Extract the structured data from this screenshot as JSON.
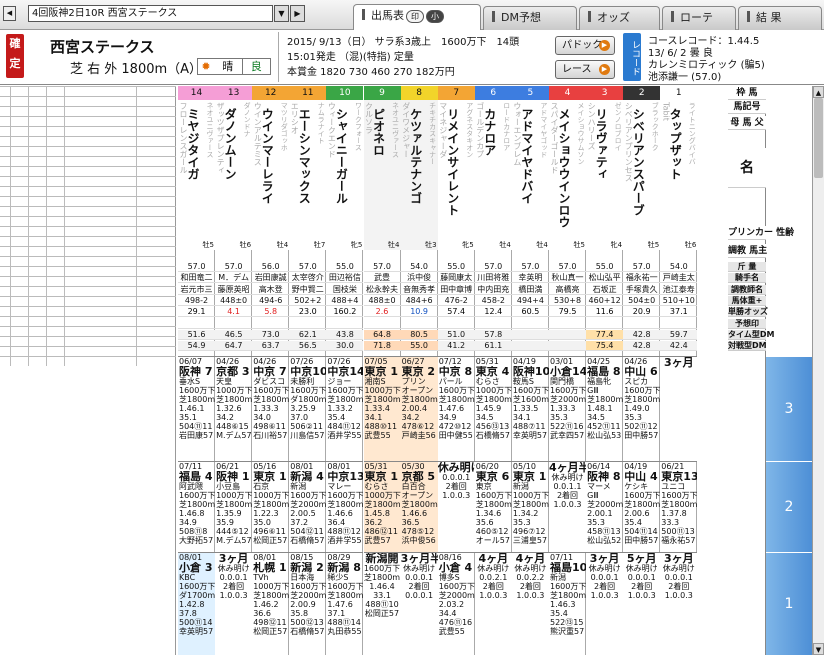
{
  "app": {
    "race_select": "4回阪神2日10R 西宮ステークス",
    "tabs": [
      {
        "label": "出馬表",
        "pills": [
          "印",
          "小"
        ],
        "active": true
      },
      {
        "label": "DM予想",
        "pills": [],
        "active": false
      },
      {
        "label": "オッズ",
        "pills": [],
        "active": false
      },
      {
        "label": "ローテ",
        "pills": [],
        "active": false
      },
      {
        "label": "結 果",
        "pills": [],
        "active": false
      }
    ]
  },
  "header": {
    "status": "確定",
    "race_name": "西宮ステークス",
    "course": "芝 右 外 1800m（A）",
    "weather": "晴",
    "ground": "良",
    "line1": "2015/ 9/13（日） サラ系3歳上　1600万下　14頭",
    "line2": "15:01発走 （混)(特指) 定量",
    "line3": "本賞金 1820 730 460 270 182万円",
    "paddock_label": "パドック",
    "race_label": "レース",
    "record_label": "レコード",
    "course_record": "コースレコード：1.44.5",
    "record_date": "13/ 6/ 2 曇 良",
    "record_horse": "カレンミロティック (騙5)",
    "record_jockey": "池添謙一 (57.0)"
  },
  "colors": {
    "w1": "#ffffff",
    "w2": "#333333",
    "w3": "#e84040",
    "w4": "#3d7de0",
    "w5": "#f2d42a",
    "w6": "#3aa646",
    "w7": "#f3a534",
    "w8": "#f59ed6",
    "tier": "#5a9ad9",
    "highlight": "#ffe0c0",
    "blueish": "#cfe5ff"
  },
  "right_labels": {
    "waku": "枠 馬",
    "umaban": "馬記号",
    "name_block": "母 馬 父",
    "name": "名",
    "breeder": "プリンカー 性齢",
    "owner": "調教 馬主",
    "rows": [
      "斤 量",
      "騎手名",
      "調教師名",
      "馬体重+",
      "単勝オッズ",
      "予想印",
      "タイム型DM",
      "対戦型DM"
    ]
  },
  "tiers": [
    "3",
    "2",
    "1"
  ],
  "horses": [
    {
      "waku": "14",
      "waku_c": "#f59ed6",
      "sire": "フローレンスガール",
      "name": "ミヤジタイガ",
      "dam": "ネオユニヴァース",
      "sex": "牡5",
      "weight": "57.0",
      "jockey": "和田竜二",
      "trainer": "岩元市三",
      "bw": "498-2",
      "odds": "29.1",
      "odds_c": "#000000",
      "dm1": "51.6",
      "dm2": "54.9",
      "p3": [
        "06/07",
        "阪神 7",
        "垂水S",
        "1600万下",
        "芝1800m",
        "1.46.1",
        "35.1",
        "504⑪11",
        "岩田康57"
      ],
      "p3r": "7",
      "p2": [
        "07/11",
        "福島 4",
        "阿武隈",
        "1600万下",
        "芝1800m",
        "1.46.8",
        "34.9",
        "508⑪8",
        "大野拓57"
      ],
      "p2r": "4",
      "p1": [
        "08/01",
        "小倉 3",
        "KBC",
        "1600万下",
        "ダ1700m",
        "1.42.8",
        "37.8",
        "500⑪14",
        "幸英明57"
      ],
      "p1r": "3"
    },
    {
      "waku": "13",
      "waku_c": "#f59ed6",
      "sire": "ザッツザプレンティ",
      "name": "ダノンムーン",
      "dam": "ダノンドナ",
      "sex": "牡6",
      "weight": "57.0",
      "jockey": "M．デム",
      "trainer": "藤原英昭",
      "bw": "448±0",
      "odds": "4.1",
      "odds_c": "#e02020",
      "dm1": "46.5",
      "dm2": "64.7",
      "p3": [
        "04/26",
        "京都 3",
        "天皇",
        "1000万下",
        "芝1800m",
        "1.32.6",
        "34.2",
        "448⑥15",
        "M.デム57"
      ],
      "p3r": "3",
      "p2": [
        "06/21",
        "阪神 1",
        "小豆島",
        "1000万下",
        "芝1800m",
        "1.35.9",
        "35.9",
        "444⑤12",
        "M.デム57"
      ],
      "p2r": "1",
      "p1": [
        "",
        "3ヶ月",
        "",
        "休み明け",
        "0.0.0.1",
        "2着回",
        "",
        "1.0.0.3",
        ""
      ],
      "p1r": ""
    },
    {
      "waku": "12",
      "waku_c": "#f3a534",
      "sire": "ウインアルテミス",
      "name": "ウインマーレライ",
      "dam": "マツリダゴッホ",
      "sex": "牡4",
      "weight": "56.0",
      "jockey": "岩田康誠",
      "trainer": "高木登",
      "bw": "494-6",
      "odds": "5.8",
      "odds_c": "#e02020",
      "dm1": "73.0",
      "dm2": "63.7",
      "p3": [
        "04/26",
        "中京 7",
        "ダビスコ",
        "1600万下",
        "芝1800m",
        "1.33.3",
        "34.0",
        "498⑥11",
        "石川裕57"
      ],
      "p3r": "7",
      "p2": [
        "05/16",
        "東京 1",
        "石京",
        "1000万下",
        "芝1800m",
        "1.22.3",
        "35.0",
        "496⑥11",
        "松岡正57"
      ],
      "p2r": "1",
      "p1": [
        "08/01",
        "札幌 1",
        "TVh",
        "1000万下",
        "芝1800m",
        "1.46.2",
        "36.6",
        "498⑫11",
        "松岡正57"
      ],
      "p1r": "1"
    },
    {
      "waku": "11",
      "waku_c": "#f3a534",
      "sire": "エリシオ",
      "name": "エーシンマックス",
      "dam": "ナムラナイト",
      "sex": "牡7",
      "weight": "57.0",
      "jockey": "太宰啓介",
      "trainer": "野中賢二",
      "bw": "502+2",
      "odds": "23.0",
      "odds_c": "#000000",
      "dm1": "62.1",
      "dm2": "56.5",
      "p3": [
        "07/26",
        "中京10",
        "未勝利",
        "1600万下",
        "ダ1800m",
        "3.25.9",
        "37.0",
        "506②11",
        "川島信57"
      ],
      "p3r": "10",
      "p2": [
        "08/01",
        "新潟 4",
        "新潟",
        "1600万下",
        "芝2000m",
        "2.00.5",
        "37.2",
        "504⑫11",
        "石橋脩57"
      ],
      "p2r": "4",
      "p1": [
        "08/15",
        "新潟 2",
        "日本海",
        "1600万下",
        "芝2000m",
        "2.00.9",
        "35.8",
        "500⑫13",
        "石橋脩57"
      ],
      "p1r": "2"
    },
    {
      "waku": "10",
      "waku_c": "#3aa646",
      "sire": "ウィークエンド",
      "name": "シャイニーガール",
      "dam": "ワークフォース",
      "sex": "牝5",
      "weight": "55.0",
      "jockey": "田辺裕信",
      "trainer": "国枝栄",
      "bw": "488+4",
      "odds": "160.2",
      "odds_c": "#000000",
      "dm1": "43.8",
      "dm2": "30.0",
      "p3": [
        "07/26",
        "中京14",
        "ジョー",
        "1600万下",
        "芝1800m",
        "1.33.2",
        "35.4",
        "484⑪12",
        "酒井学55"
      ],
      "p3r": "14",
      "p2": [
        "08/01",
        "中京13",
        "マレー",
        "1600万下",
        "芝1800m",
        "1.46.6",
        "36.4",
        "488⑪12",
        "酒井学55"
      ],
      "p2r": "13",
      "p1": [
        "08/29",
        "新潟 8",
        "稀少S",
        "1600万下",
        "芝1800m",
        "1.47.6",
        "37.1",
        "488⑪14",
        "丸田恭55"
      ],
      "p1r": "8"
    },
    {
      "waku": "9",
      "waku_c": "#3aa646",
      "sire": "クルソラ",
      "name": "ピオネロ",
      "dam": "ネオユニヴァース",
      "sex": "牡4",
      "weight": "57.0",
      "jockey": "武豊",
      "trainer": "松永幹夫",
      "bw": "488±0",
      "odds": "2.6",
      "odds_c": "#e02020",
      "dm1": "64.8",
      "dm2": "71.8",
      "hl": true,
      "p3": [
        "07/05",
        "東京 1",
        "湘南S",
        "1000万下",
        "芝1800m",
        "1.33.4",
        "34.1",
        "488⑩11",
        "武豊55"
      ],
      "p3r": "1",
      "p2": [
        "05/31",
        "東京 1",
        "むらさ",
        "1000万下",
        "芝1800m",
        "1.45.8",
        "36.2",
        "486⑫11",
        "武豊57"
      ],
      "p2r": "1",
      "p1": [
        "",
        "新潟開",
        "",
        "1600万下",
        "芝1800m",
        "1.46.4",
        "33.1",
        "488⑪10",
        "松岡正57"
      ],
      "p1r": ""
    },
    {
      "waku": "8",
      "waku_c": "#f2d42a",
      "sire": "ダイワメジャー",
      "name": "ケツァルテナンゴ",
      "dam": "チキチカスキャナー",
      "sex": "牡3",
      "weight": "54.0",
      "jockey": "浜中俊",
      "trainer": "音無秀孝",
      "bw": "484+6",
      "odds": "10.9",
      "odds_c": "#1050c0",
      "dm1": "80.5",
      "dm2": "55.0",
      "hl": true,
      "p3": [
        "06/27",
        "東京 2",
        "プリン",
        "オープン",
        "芝1800m",
        "2.00.4",
        "34.2",
        "478⑥12",
        "戸崎圭56"
      ],
      "p3r": "2",
      "p2": [
        "05/30",
        "京都 5",
        "白百合",
        "オープン",
        "芝1800m",
        "1.46.6",
        "36.5",
        "478⑤12",
        "浜中俊56"
      ],
      "p2r": "5",
      "p1": [
        "",
        "3ヶ月半",
        "",
        "休み明け",
        "0.0.0.1",
        "2着回",
        "",
        "0.0.0.1",
        ""
      ],
      "p1r": ""
    },
    {
      "waku": "7",
      "waku_c": "#f3a534",
      "sire": "マイネジャーダ",
      "name": "リメインサイレント",
      "dam": "アグネスタキオン",
      "sex": "牝5",
      "weight": "55.0",
      "jockey": "藤岡康太",
      "trainer": "田中章博",
      "bw": "476-2",
      "odds": "57.4",
      "odds_c": "#000000",
      "dm1": "51.0",
      "dm2": "41.2",
      "p3": [
        "07/12",
        "中京 8",
        "パール",
        "1600万下",
        "芝1800m",
        "1.47.6",
        "34.9",
        "472⑩12",
        "田中健55"
      ],
      "p3r": "8",
      "p2": [
        "",
        "休み明け",
        "",
        "0.0.0.1",
        "2着回",
        "",
        "",
        "1.0.0.3",
        ""
      ],
      "p2r": "",
      "p1": [
        "08/16",
        "小倉 4",
        "博多S",
        "1600万下",
        "芝2000m",
        "2.03.2",
        "34.4",
        "476⑪16",
        "武豊55"
      ],
      "p1r": "4"
    },
    {
      "waku": "6",
      "waku_c": "#3d7de0",
      "sire": "ゴールデンカプ",
      "name": "カナロア",
      "dam": "ロードカナロア",
      "sex": "牡4",
      "weight": "57.0",
      "jockey": "川田将雅",
      "trainer": "中内田充",
      "bw": "458-2",
      "odds": "12.4",
      "odds_c": "#000000",
      "dm1": "57.8",
      "dm2": "61.1",
      "p3": [
        "05/31",
        "東京 4",
        "むらさ",
        "1000万下",
        "芝1800m",
        "1.45.9",
        "34.5",
        "456⑬13",
        "石橋脩57"
      ],
      "p3r": "4",
      "p2": [
        "06/20",
        "東京 6",
        "東京",
        "1600万下",
        "芝1800m",
        "1.34.6",
        "35.6",
        "460⑤12",
        "オール57"
      ],
      "p2r": "6",
      "p1": [
        "",
        "4ヶ月",
        "",
        "休み明け",
        "0.0.2.1",
        "2着回",
        "",
        "1.0.0.3",
        ""
      ],
      "p1r": ""
    },
    {
      "waku": "5",
      "waku_c": "#3d7de0",
      "sire": "ウォーエンブレム",
      "name": "アドマイヤドバイ",
      "dam": "アドマイヤゴッド",
      "sex": "牡4",
      "weight": "57.0",
      "jockey": "幸英明",
      "trainer": "橋田満",
      "bw": "494+4",
      "odds": "60.5",
      "odds_c": "#000000",
      "dm1": "",
      "dm2": "",
      "p3": [
        "04/19",
        "阪神10",
        "鞍馬S",
        "1600万下",
        "芝1600m",
        "1.33.5",
        "34.1",
        "488⑦11",
        "幸英明57"
      ],
      "p3r": "10",
      "p2": [
        "05/10",
        "東京 1",
        "新潟",
        "1000万下",
        "芝1800m",
        "1.34.2",
        "35.3",
        "496⑦12",
        "三浦皇57"
      ],
      "p2r": "1",
      "p1": [
        "",
        "4ヶ月",
        "",
        "休み明け",
        "0.0.2.2",
        "2着回",
        "",
        "1.0.0.3",
        ""
      ],
      "p1r": ""
    },
    {
      "waku": "4",
      "waku_c": "#e84040",
      "sire": "スパイダーゴールド",
      "name": "メイショウウインロウ",
      "dam": "メイショウサムソン",
      "sex": "牡5",
      "weight": "57.0",
      "jockey": "秋山真一",
      "trainer": "高橋亮",
      "bw": "530+8",
      "odds": "79.5",
      "odds_c": "#000000",
      "dm1": "",
      "dm2": "",
      "p3": [
        "03/01",
        "小倉14",
        "関門橋",
        "1600万下",
        "芝2000m",
        "1.33.3",
        "35.3",
        "522⑪16",
        "武幸四57"
      ],
      "p3r": "14",
      "p2": [
        "",
        "4ヶ月半",
        "",
        "休み明け",
        "0.0.1.1",
        "2着回",
        "",
        "1.0.0.3",
        ""
      ],
      "p2r": "",
      "p1": [
        "07/11",
        "福島10",
        "新潟",
        "1600万下",
        "芝1800m",
        "1.46.3",
        "35.4",
        "522⑬15",
        "熊沢重57"
      ],
      "p1r": "10"
    },
    {
      "waku": "3",
      "waku_c": "#e84040",
      "sire": "シンハリーズ",
      "name": "リラヴァティ",
      "dam": "ゼンノロブロイ",
      "sex": "牝4",
      "weight": "55.0",
      "jockey": "松山弘平",
      "trainer": "石坂正",
      "bw": "460+12",
      "odds": "11.6",
      "odds_c": "#000000",
      "dm1": "77.4",
      "dm2": "75.4",
      "hl2": true,
      "p3": [
        "04/25",
        "福島 8",
        "福島牝",
        "GⅢ",
        "芝1800m",
        "1.48.1",
        "34.5",
        "452⑪11",
        "松山弘53"
      ],
      "p3r": "8",
      "p2": [
        "06/14",
        "阪神 8",
        "マーメ",
        "GⅢ",
        "芝2000m",
        "2.00.1",
        "35.3",
        "458⑪13",
        "松山弘52"
      ],
      "p2r": "8",
      "p1": [
        "",
        "3ヶ月",
        "",
        "休み明け",
        "0.0.0.1",
        "2着回",
        "",
        "1.0.0.3",
        ""
      ],
      "p1r": ""
    },
    {
      "waku": "2",
      "waku_c": "#333333",
      "sire": "シベリアンプリンセス",
      "name": "シベリアンスパーブ",
      "dam": "ブラックホーク",
      "sex": "牡5",
      "weight": "57.0",
      "jockey": "福永祐一",
      "trainer": "手塚貴久",
      "bw": "504±0",
      "odds": "20.9",
      "odds_c": "#000000",
      "dm1": "42.8",
      "dm2": "42.8",
      "p3": [
        "04/26",
        "中山 6",
        "スピカ",
        "1600万下",
        "芝1800m",
        "1.49.0",
        "35.3",
        "502⑪12",
        "田中勝57"
      ],
      "p3r": "6",
      "p2": [
        "04/19",
        "中山 4",
        "ケシキ",
        "1600万下",
        "芝1800m",
        "2.00.6",
        "35.4",
        "504⑪14",
        "田中勝57"
      ],
      "p2r": "4",
      "p1": [
        "",
        "5ヶ月",
        "",
        "休み明け",
        "0.0.0.1",
        "2着回",
        "",
        "1.0.0.3",
        ""
      ],
      "p1r": ""
    },
    {
      "waku": "1",
      "waku_c": "#ffffff",
      "sire": "Tabit",
      "name": "タップザット",
      "dam": "ライトニングバイバ",
      "sex": "牡6",
      "weight": "54.0",
      "jockey": "戸崎圭太",
      "trainer": "池江泰寿",
      "bw": "510+10",
      "odds": "37.1",
      "odds_c": "#000000",
      "dm1": "59.7",
      "dm2": "42.4",
      "p3": [
        "",
        "3ヶ月",
        "",
        "",
        "",
        "",
        "",
        "",
        ""
      ],
      "p3r": "",
      "p2": [
        "06/21",
        "東京13",
        "ユニコ",
        "1600万下",
        "芝1800m",
        "1.37.8",
        "33.3",
        "500⑪13",
        "福永祐57"
      ],
      "p2r": "13",
      "p1": [
        "",
        "3ヶ月",
        "",
        "休み明け",
        "0.0.0.1",
        "2着回",
        "",
        "1.0.0.3",
        ""
      ],
      "p1r": ""
    }
  ]
}
